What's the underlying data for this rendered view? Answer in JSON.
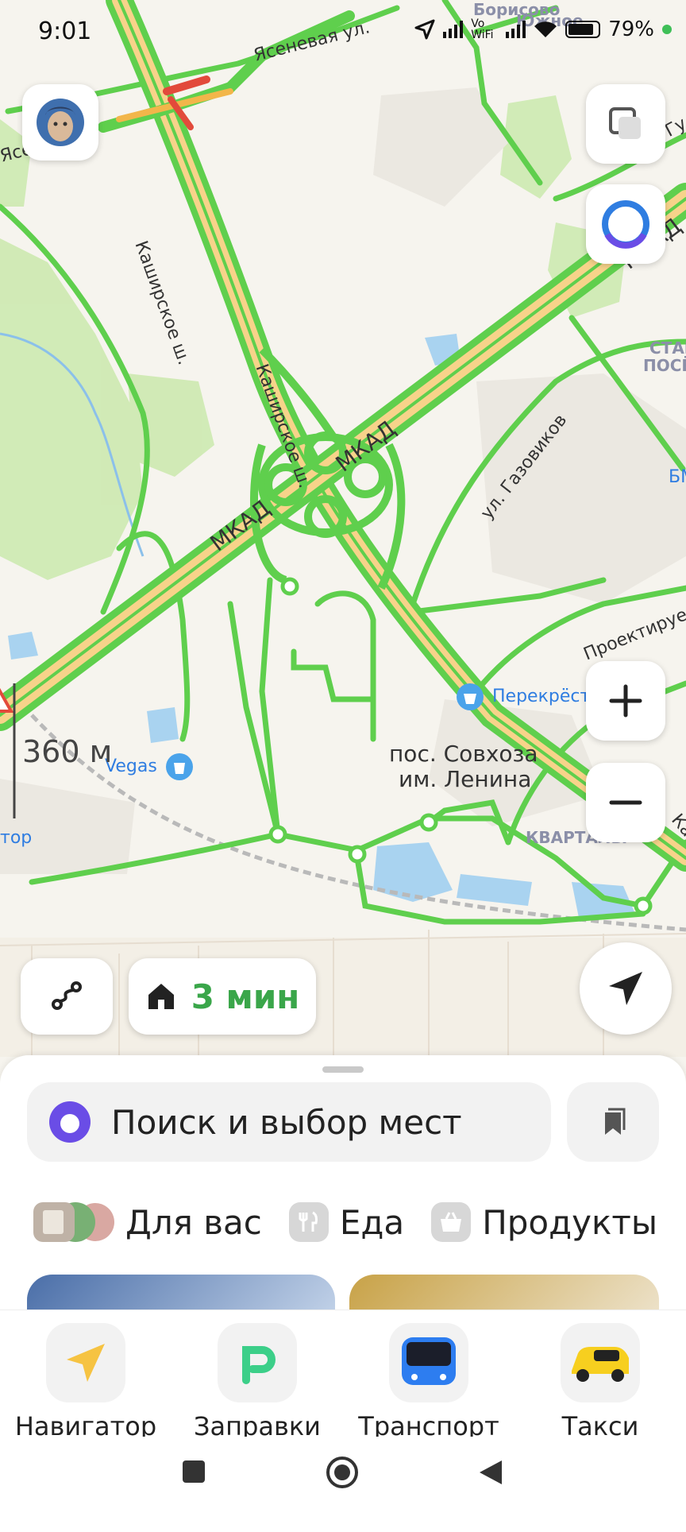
{
  "status_bar": {
    "time": "9:01",
    "network": "Vo WiFi",
    "battery": "79%"
  },
  "map": {
    "roads": {
      "mkad_1": "МКАД",
      "mkad_2": "МКАД",
      "mkad_top": "МКАД",
      "kashirskoe_1": "Каширское ш.",
      "kashirskoe_2": "Каширское ш.",
      "kashirskoe_right": "Кашир",
      "yasenevaya": "Ясеневая ул.",
      "yase_left": "Ясе",
      "gazovikov": "ул. Газовиков",
      "proektiruemy": "Проектируемы",
      "gu": "Гу"
    },
    "places": {
      "borisovo": "Борисово",
      "yuzhnoe": "Южное",
      "settlement_line1": "пос. Совхоза",
      "settlement_line2": "им. Ленина",
      "kvartal": "КВАРТАЛЫ",
      "star_1": "СТАР",
      "star_2": "ПОСЁ",
      "bm": "БМ",
      "tor": "тор"
    },
    "pois": {
      "perekrestok": "Перекрёсток",
      "vegas": "Vegas"
    },
    "scale_label": "360 м",
    "colors": {
      "traffic_free": "#5fcf4d",
      "major_road": "#f7d38a",
      "traffic_jam": "#e24a3b",
      "water": "#a9d3f0",
      "park": "#cdeab0"
    }
  },
  "controls": {
    "home_eta": "3 мин",
    "icons": [
      "avatar",
      "layers-icon",
      "alice-icon",
      "zoom-in-icon",
      "zoom-out-icon",
      "route-icon",
      "home-icon",
      "locate-arrow-icon"
    ]
  },
  "sheet": {
    "search_placeholder": "Поиск и выбор мест",
    "categories": [
      {
        "label": "Для вас",
        "icon": "for-you-thumbnails"
      },
      {
        "label": "Еда",
        "icon": "fork-knife-icon"
      },
      {
        "label": "Продукты",
        "icon": "basket-icon"
      }
    ]
  },
  "services": [
    {
      "label": "Навигатор",
      "icon": "navigator-arrow-icon"
    },
    {
      "label": "Заправки",
      "icon": "fuel-p-icon"
    },
    {
      "label": "Транспорт",
      "icon": "bus-icon"
    },
    {
      "label": "Такси",
      "icon": "taxi-car-icon"
    }
  ]
}
